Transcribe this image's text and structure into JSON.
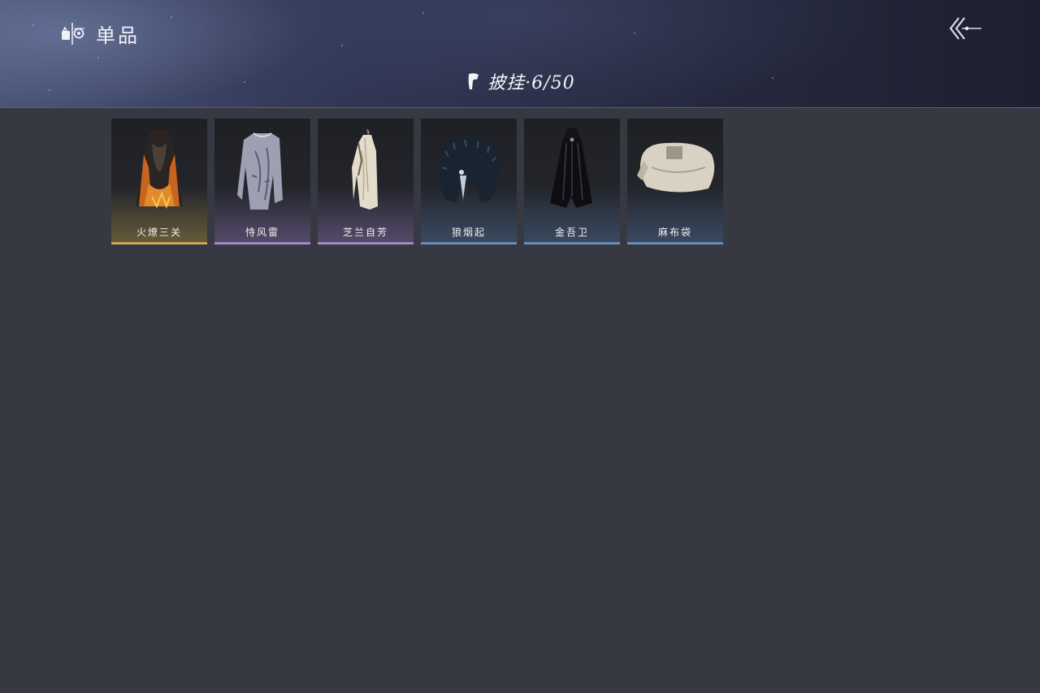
{
  "header": {
    "title": "单品",
    "title_icon": "item-set-icon",
    "back_icon": "back-arrow-icon"
  },
  "category": {
    "name": "披挂",
    "separator": "·",
    "owned": 6,
    "total": 50,
    "count_text": "6/50",
    "icon": "cape-icon"
  },
  "items": [
    {
      "name": "火燎三关",
      "rarity_color": "#b8953f",
      "art": "flame-cape-icon"
    },
    {
      "name": "恃风雷",
      "rarity_color": "#8c6fb0",
      "art": "grey-robe-icon"
    },
    {
      "name": "芝兰自芳",
      "rarity_color": "#8c6fb0",
      "art": "white-robe-icon"
    },
    {
      "name": "狼烟起",
      "rarity_color": "#4e6f9a",
      "art": "fur-collar-icon"
    },
    {
      "name": "金吾卫",
      "rarity_color": "#4e6f9a",
      "art": "black-cloak-icon"
    },
    {
      "name": "麻布袋",
      "rarity_color": "#4e6f9a",
      "art": "sack-icon"
    }
  ]
}
